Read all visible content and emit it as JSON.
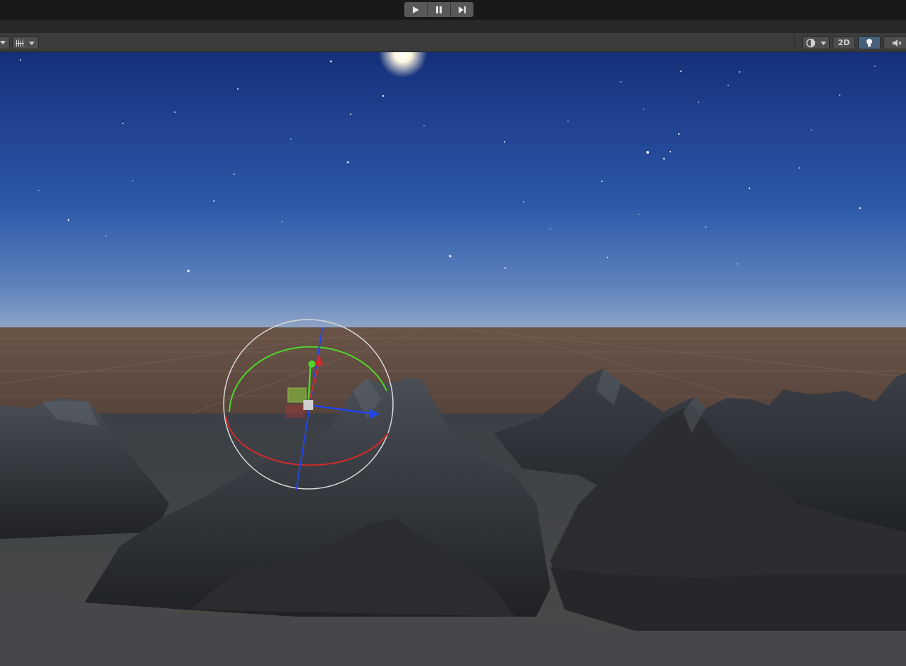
{
  "play_controls": {
    "play_icon": "play-icon",
    "pause_icon": "pause-icon",
    "step_icon": "step-forward-icon"
  },
  "scene_toolbar": {
    "left_dropdown_icon": "chevron-down-icon",
    "grid_snap_icon": "grid-snapping-icon",
    "draw_mode_icon": "shading-mode-icon",
    "two_d_label": "2D",
    "lighting_icon": "light-bulb-icon",
    "audio_icon": "audio-mute-icon"
  },
  "scene": {
    "sky_top_color": "#15307a",
    "sky_horizon_color": "#8fa4c4",
    "ground_color": "#5e4a40",
    "terrain_color": "#2e3032",
    "gizmo": {
      "x_axis_color": "#d32a2a",
      "y_axis_color": "#4ed62a",
      "z_axis_color": "#2346e8",
      "ring_color": "#d8d8d8"
    }
  }
}
